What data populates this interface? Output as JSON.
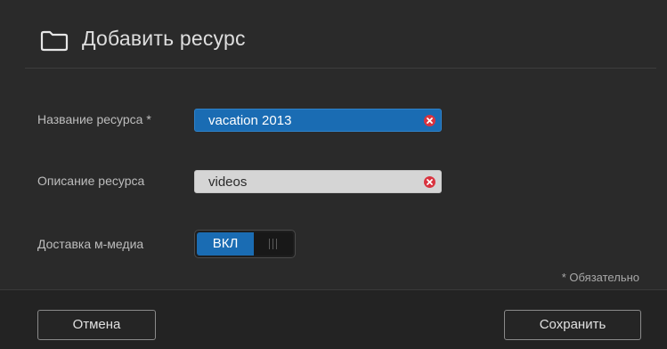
{
  "dialog": {
    "title": "Добавить ресурс",
    "title_icon": "folder-icon"
  },
  "form": {
    "share_name": {
      "label": "Название ресурса *",
      "value": "vacation 2013",
      "clear_icon": "clear-icon"
    },
    "share_description": {
      "label": "Описание ресурса",
      "value": "videos",
      "clear_icon": "clear-icon"
    },
    "media_serving": {
      "label": "Доставка м-медиа",
      "toggle_label": "ВКЛ",
      "state": "on"
    },
    "required_note": "* Обязательно"
  },
  "footer": {
    "cancel_label": "Отмена",
    "save_label": "Сохранить"
  },
  "colors": {
    "background": "#2a2a2a",
    "accent": "#1a6cb3",
    "clear_icon": "#d9333f"
  }
}
